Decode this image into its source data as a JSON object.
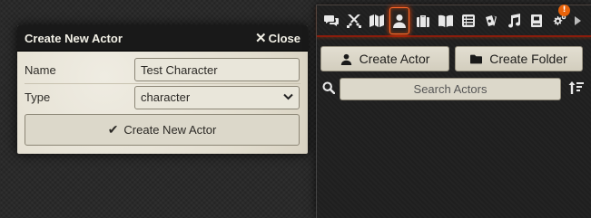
{
  "dialog": {
    "title": "Create New Actor",
    "close_label": "Close",
    "fields": {
      "name_label": "Name",
      "name_value": "Test Character",
      "type_label": "Type",
      "type_value": "character"
    },
    "submit_label": "Create New Actor"
  },
  "sidebar": {
    "tabs": [
      {
        "icon": "comments-icon",
        "active": false
      },
      {
        "icon": "crossed-swords-icon",
        "active": false
      },
      {
        "icon": "map-icon",
        "active": false
      },
      {
        "icon": "user-icon",
        "active": true
      },
      {
        "icon": "suitcase-icon",
        "active": false
      },
      {
        "icon": "book-open-icon",
        "active": false
      },
      {
        "icon": "table-list-icon",
        "active": false
      },
      {
        "icon": "cards-icon",
        "active": false
      },
      {
        "icon": "music-icon",
        "active": false
      },
      {
        "icon": "compendium-icon",
        "active": false
      },
      {
        "icon": "cogs-icon",
        "active": false,
        "badge": "!"
      },
      {
        "icon": "caret-right-icon",
        "active": false
      }
    ],
    "settings_badge": "!",
    "create_actor_label": "Create Actor",
    "create_folder_label": "Create Folder",
    "search_placeholder": "Search Actors"
  },
  "colors": {
    "accent": "#ff6a2b",
    "tab_border": "#8b1c0c",
    "parchment": "#e7e3d6",
    "header_bg": "#191919",
    "badge": "#e8630a"
  }
}
